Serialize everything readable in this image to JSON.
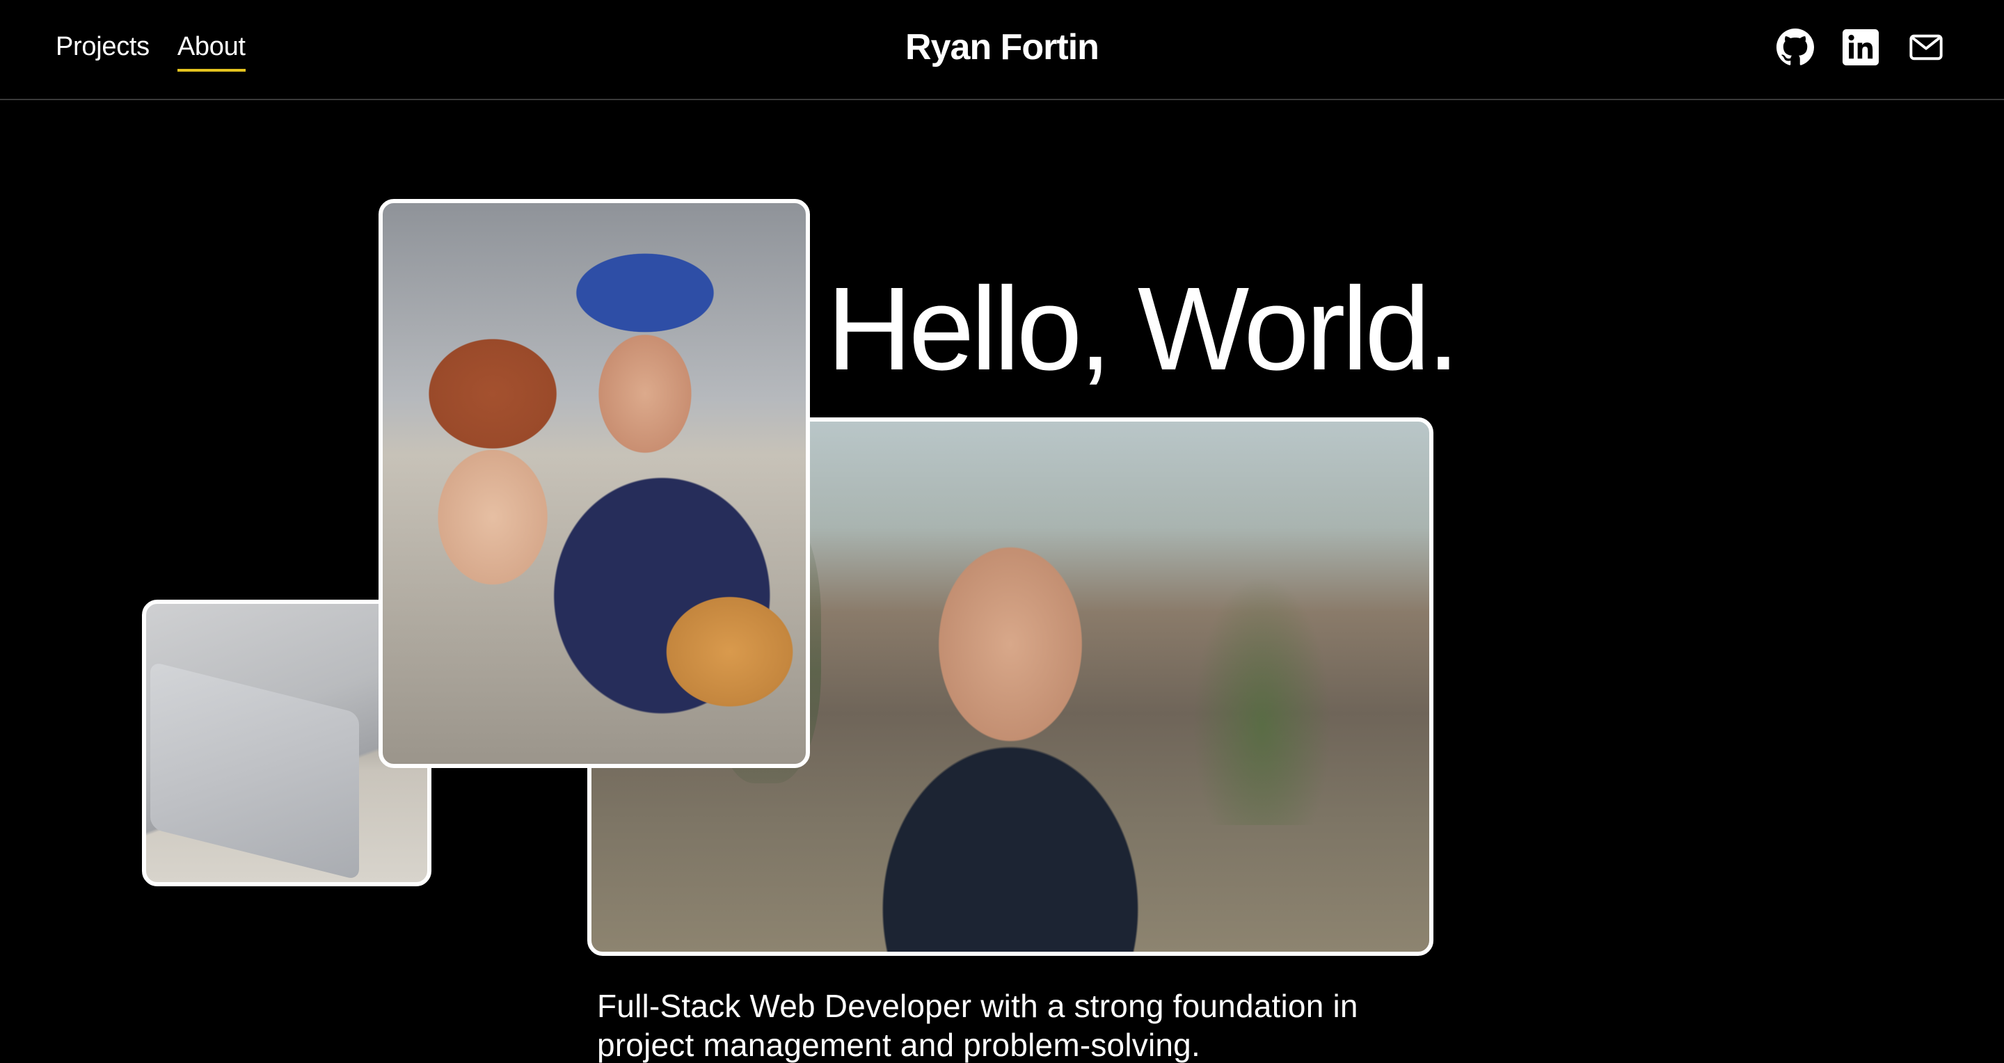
{
  "header": {
    "nav": [
      {
        "label": "Projects",
        "active": false
      },
      {
        "label": "About",
        "active": true
      }
    ],
    "brand": "Ryan Fortin",
    "social": [
      {
        "icon": "github-icon"
      },
      {
        "icon": "linkedin-icon"
      },
      {
        "icon": "mail-icon"
      }
    ]
  },
  "hero": {
    "title": "Hello, World.",
    "tagline": "Full-Stack Web Developer with a strong foundation in project management and problem-solving."
  },
  "colors": {
    "background": "#000000",
    "text": "#ffffff",
    "active_underline": "#e3c31f",
    "divider": "#3a3a3a"
  }
}
